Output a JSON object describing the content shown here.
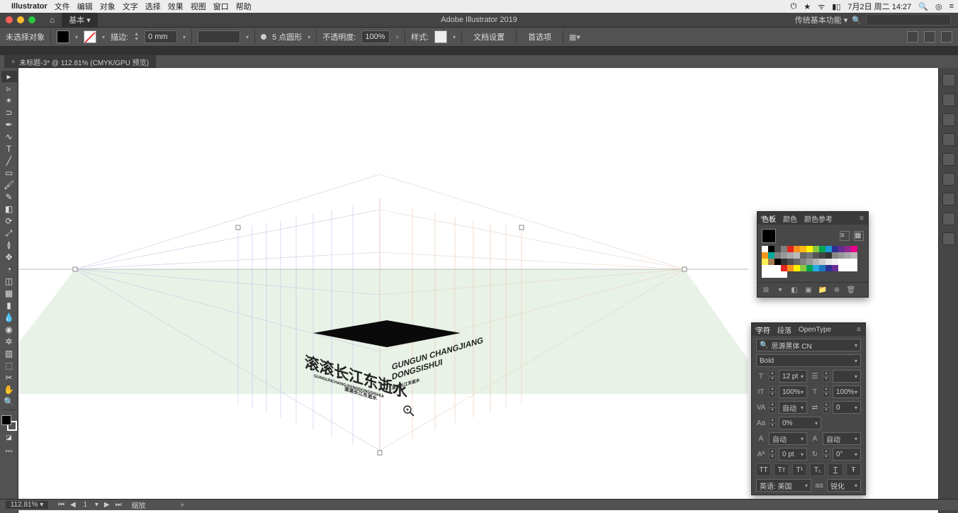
{
  "mac_menubar": {
    "app_name": "Illustrator",
    "menus": [
      "文件",
      "编辑",
      "对象",
      "文字",
      "选择",
      "效果",
      "视图",
      "窗口",
      "帮助"
    ],
    "right": {
      "date": "7月2日 周二 14:27"
    }
  },
  "app_bar": {
    "title": "Adobe Illustrator 2019",
    "basic_tab": "基本",
    "workspace": "传统基本功能"
  },
  "control_bar": {
    "selection_label": "未选择对象",
    "stroke_label": "描边:",
    "stroke_value": "0 mm",
    "profile_label": "5 点圆形",
    "opacity_label": "不透明度:",
    "opacity_value": "100%",
    "style_label": "样式:",
    "doc_setup": "文档设置",
    "preferences": "首选项"
  },
  "doc_tab": "未标题-3* @ 112.81% (CMYK/GPU 预览)",
  "artwork": {
    "cn_title": "滚滚长江东逝水",
    "cn_sub1": "GUNGUNCHANGJIANGDONGSISHUI",
    "cn_sub2": "滚滚长江东逝水",
    "en_line1": "GUNGUN CHANGJIANG",
    "en_line2": "DONGSISHUI",
    "en_sub": "滚滚长江东逝水"
  },
  "swatches_panel": {
    "tabs": [
      "色板",
      "颜色",
      "颜色参考"
    ]
  },
  "char_panel": {
    "tabs": [
      "字符",
      "段落",
      "OpenType"
    ],
    "font": "思源黑体 CN",
    "weight": "Bold",
    "size": "12 pt",
    "leading_icon": "≡",
    "hscale": "100%",
    "vscale": "100%",
    "kerning": "自动",
    "tracking": "0",
    "baseline": "0%",
    "auto1": "自动",
    "auto2": "自动",
    "shift": "0 pt",
    "rotate": "0°",
    "language_label": "英语: 美国",
    "antialias_label": "锐化"
  },
  "status": {
    "zoom": "112.81%",
    "artboard_current": "1",
    "tool_hint": "缩放"
  },
  "swatch_colors": [
    "#ffffff",
    "#000000",
    "#4d4d4d",
    "#808080",
    "#e52620",
    "#f7931e",
    "#fdb913",
    "#fff200",
    "#8cc63f",
    "#00a651",
    "#1c9ad6",
    "#2e3192",
    "#662d91",
    "#92278f",
    "#ec008c",
    "#f7941d",
    "#00a99d",
    "#808080",
    "#999999",
    "#aaaaaa",
    "#bbbbbb",
    "#666666",
    "#777777",
    "#555555",
    "#444444",
    "#333333",
    "#888888",
    "#9a9a9a",
    "#a8a8a8",
    "#b8b8b8",
    "#fcef56",
    "#a57c52",
    "#000000",
    "#333333",
    "#4d4d4d",
    "#666666",
    "#808080",
    "#999999",
    "#b3b3b3",
    "#cccccc",
    "#e6e6e6",
    "#f2f2f2",
    "#ffffff",
    "#ffffff",
    "#ffffff",
    "#ffffff",
    "#ffffff",
    "#ffffff",
    "#e52620",
    "#f7941d",
    "#fff200",
    "#8cc63f",
    "#00a651",
    "#27aae1",
    "#1c75bc",
    "#2e3192",
    "#662d91",
    "#ffffff",
    "#ffffff",
    "#ffffff",
    "#ffffff",
    "#ffffff",
    "#ffffff",
    "#ffffff"
  ]
}
